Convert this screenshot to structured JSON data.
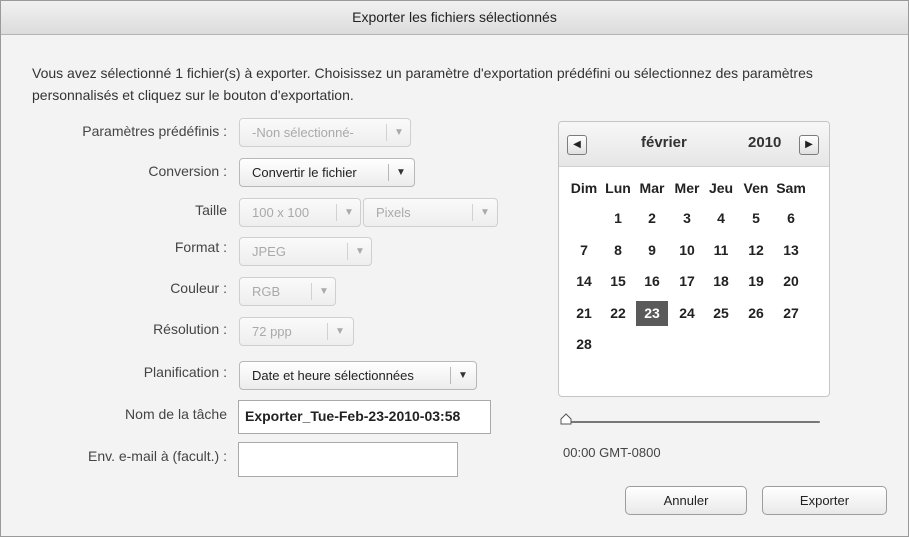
{
  "dialog": {
    "title": "Exporter les fichiers sélectionnés",
    "intro": "Vous avez sélectionné 1 fichier(s) à exporter. Choisissez un paramètre d'exportation prédéfini ou sélectionnez des paramètres personnalisés et cliquez sur le bouton d'exportation."
  },
  "form": {
    "preset": {
      "label": "Paramètres prédéfinis :",
      "value": "-Non sélectionné-",
      "enabled": false
    },
    "conversion": {
      "label": "Conversion :",
      "value": "Convertir le fichier",
      "enabled": true
    },
    "size": {
      "label": "Taille",
      "value": "100 x 100",
      "unit": "Pixels",
      "enabled": false
    },
    "format": {
      "label": "Format :",
      "value": "JPEG",
      "enabled": false
    },
    "color": {
      "label": "Couleur :",
      "value": "RGB",
      "enabled": false
    },
    "resolution": {
      "label": "Résolution :",
      "value": "72 ppp",
      "enabled": false
    },
    "schedule": {
      "label": "Planification :",
      "value": "Date et heure sélectionnées",
      "enabled": true
    },
    "task_name": {
      "label": "Nom de la tâche",
      "value": "Exporter_Tue-Feb-23-2010-03:58"
    },
    "email": {
      "label": "Env. e-mail à (facult.) :",
      "value": ""
    }
  },
  "calendar": {
    "month": "février",
    "year": "2010",
    "weekdays": [
      "Dim",
      "Lun",
      "Mar",
      "Mer",
      "Jeu",
      "Ven",
      "Sam"
    ],
    "days": [
      "1",
      "2",
      "3",
      "4",
      "5",
      "6",
      "7",
      "8",
      "9",
      "10",
      "11",
      "12",
      "13",
      "14",
      "15",
      "16",
      "17",
      "18",
      "19",
      "20",
      "21",
      "22",
      "23",
      "24",
      "25",
      "26",
      "27",
      "28"
    ],
    "selected_day": "23"
  },
  "time": {
    "label": "00:00 GMT-0800",
    "slider_value": 0
  },
  "buttons": {
    "cancel": "Annuler",
    "export": "Exporter"
  },
  "icons": {
    "dropdown": "chevron-down-icon",
    "prev": "triangle-left-icon",
    "next": "triangle-right-icon"
  }
}
